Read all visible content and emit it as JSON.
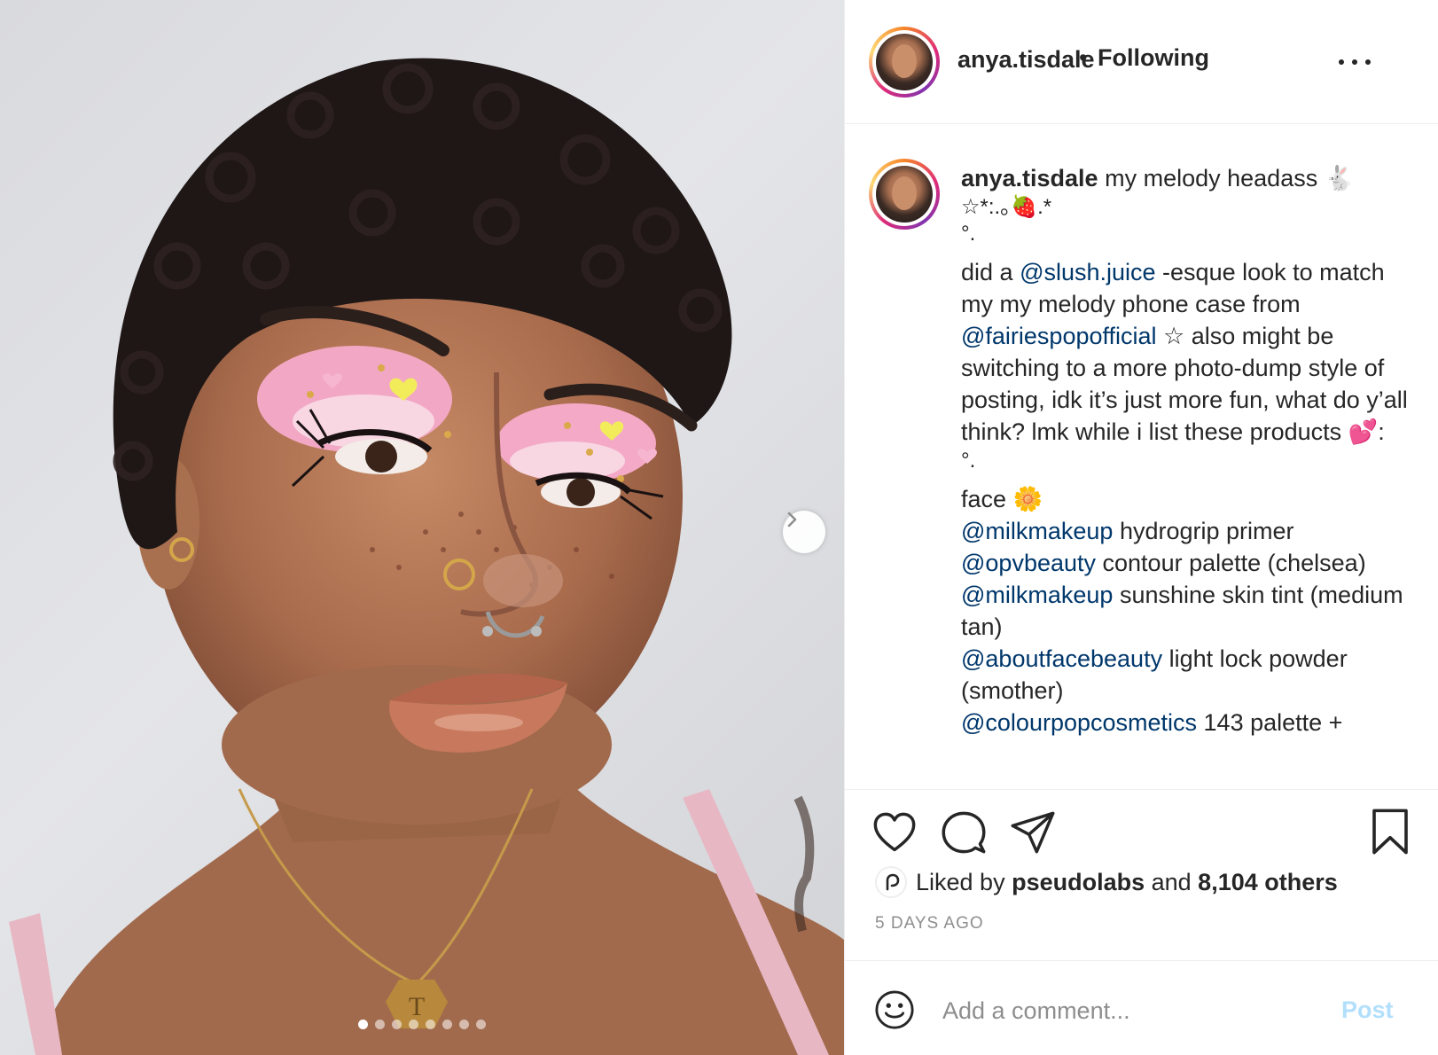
{
  "post": {
    "username": "anya.tisdale",
    "separator": "•",
    "follow_status": "Following",
    "carousel": {
      "total_slides": 8,
      "active_slide": 1
    }
  },
  "caption": {
    "username": "anya.tisdale",
    "line1": "my melody headass",
    "emoji_rabbit": "🐇",
    "deco1": "☆*:.｡🍓.*",
    "deco2": "°.",
    "p2_a": "did a ",
    "p2_m1": "@slush.juice",
    "p2_b": " -esque look to match my my melody phone case from ",
    "p2_m2": "@fairiespopofficial",
    "p2_c": " ☆ also might be switching to a more photo-dump style of posting, idk it’s just more fun, what do y’all think? lmk while i list these products 💕:",
    "deco3": "°.",
    "face_label": "face 🌼",
    "products": [
      {
        "mention": "@milkmakeup",
        "text": " hydrogrip primer"
      },
      {
        "mention": "@opvbeauty",
        "text": " contour palette (chelsea)"
      },
      {
        "mention": "@milkmakeup",
        "text": " sunshine skin tint (medium tan)"
      },
      {
        "mention": "@aboutfacebeauty",
        "text": " light lock powder (smother)"
      },
      {
        "mention": "@colourpopcosmetics",
        "text": " 143 palette +"
      }
    ]
  },
  "engagement": {
    "liked_by_prefix": "Liked by ",
    "liked_by_user": "pseudolabs",
    "liked_by_mid": " and ",
    "others": "8,104 others",
    "timestamp": "5 DAYS AGO"
  },
  "comment": {
    "placeholder": "Add a comment...",
    "post_label": "Post"
  },
  "colors": {
    "text": "#262626",
    "mention": "#00376b",
    "muted": "#8e8e8e",
    "post_disabled": "#b2dffc",
    "divider": "#efefef"
  },
  "icons": [
    "heart-icon",
    "comment-icon",
    "share-icon",
    "bookmark-icon",
    "emoji-icon",
    "chevron-right-icon",
    "more-icon"
  ]
}
